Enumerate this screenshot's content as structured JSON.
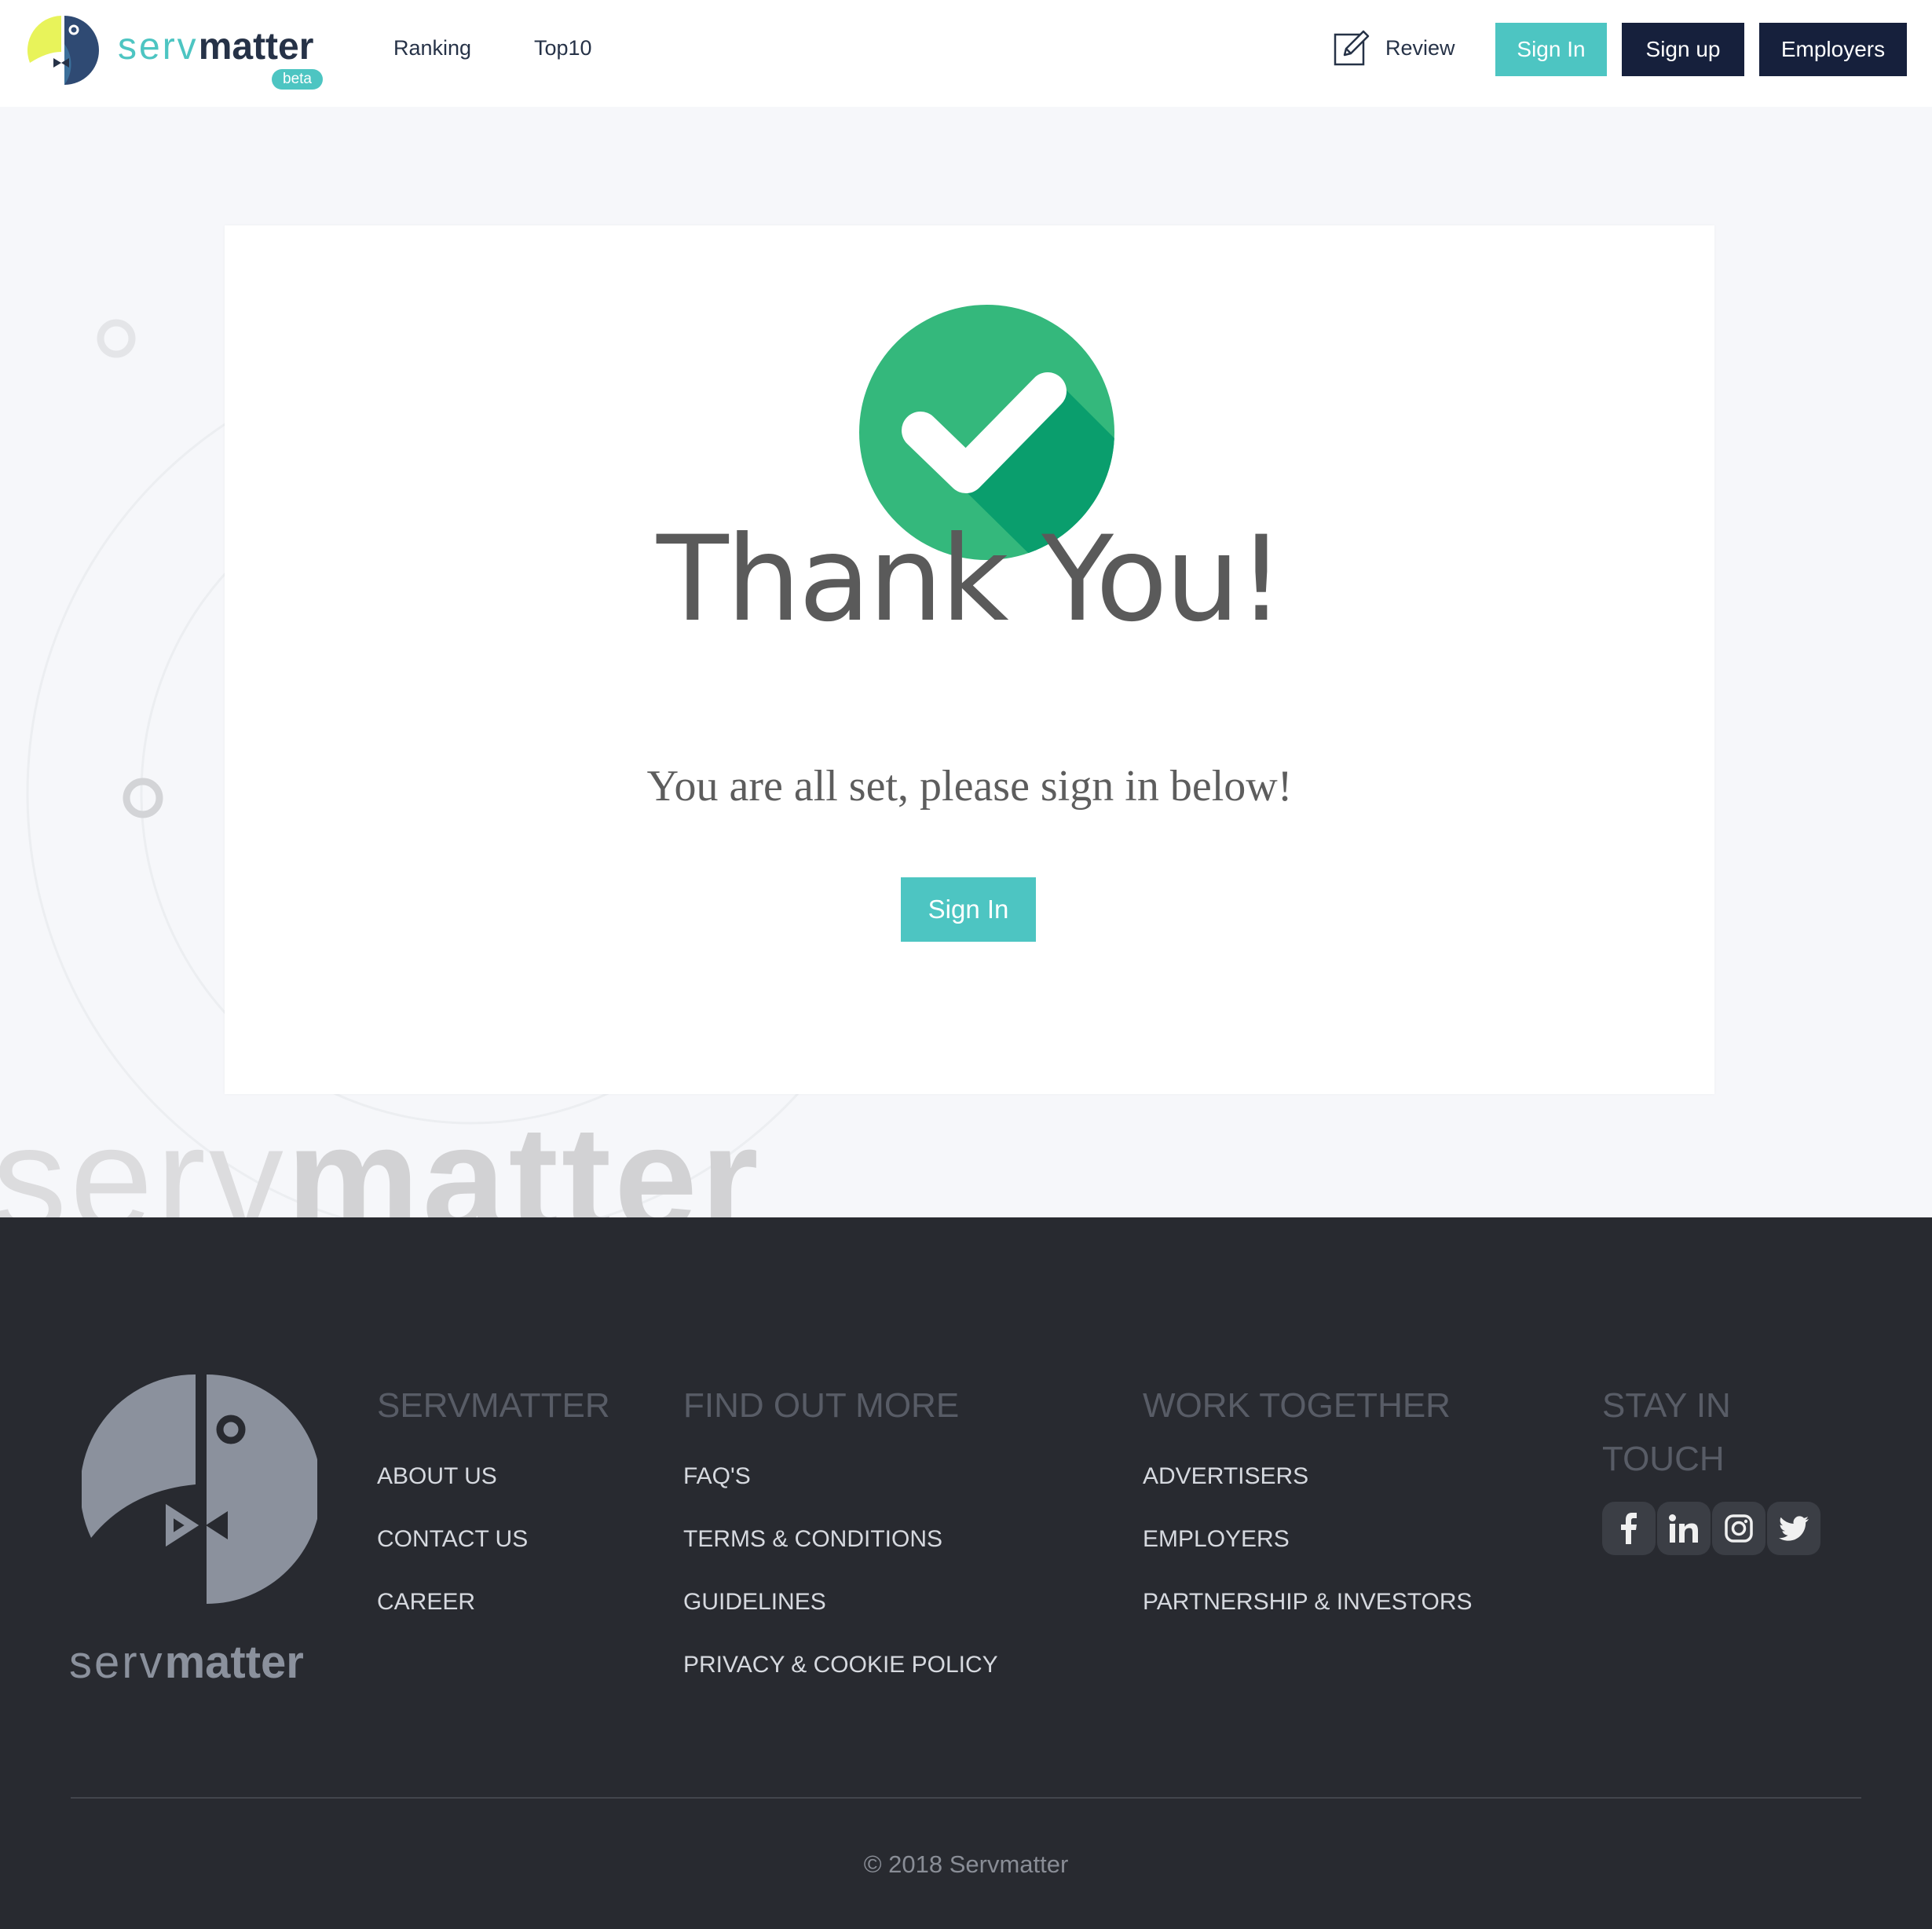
{
  "header": {
    "logo": {
      "word1": "serv",
      "word2": "matter",
      "badge": "beta"
    },
    "nav": {
      "ranking": "Ranking",
      "top10": "Top10"
    },
    "review_label": "Review",
    "sign_in": "Sign In",
    "sign_up": "Sign up",
    "employers": "Employers"
  },
  "background": {
    "watermark_word1": "serv",
    "watermark_word2": "matter"
  },
  "card": {
    "title": "Thank You!",
    "subtitle": "You are all set, please sign in below!",
    "button": "Sign In"
  },
  "footer": {
    "logo": {
      "word1": "serv",
      "word2": "matter"
    },
    "columns": [
      {
        "heading": "SERVMATTER",
        "links": [
          "ABOUT US",
          "CONTACT US",
          "CAREER"
        ]
      },
      {
        "heading": "FIND OUT MORE",
        "links": [
          "FAQ'S",
          "TERMS & CONDITIONS",
          "GUIDELINES",
          "PRIVACY & COOKIE POLICY"
        ]
      },
      {
        "heading": "WORK TOGETHER",
        "links": [
          "ADVERTISERS",
          "EMPLOYERS",
          "PARTNERSHIP & INVESTORS"
        ]
      },
      {
        "heading_line1": "STAY IN",
        "heading_line2": "TOUCH"
      }
    ],
    "socials": [
      "facebook-icon",
      "linkedin-icon",
      "instagram-icon",
      "twitter-icon"
    ],
    "copyright": "© 2018 Servmatter"
  },
  "colors": {
    "teal": "#4dc5c2",
    "navy": "#16203c",
    "check_green": "#34b87c",
    "footer_bg": "#282a30",
    "page_bg": "#f6f7fa"
  }
}
